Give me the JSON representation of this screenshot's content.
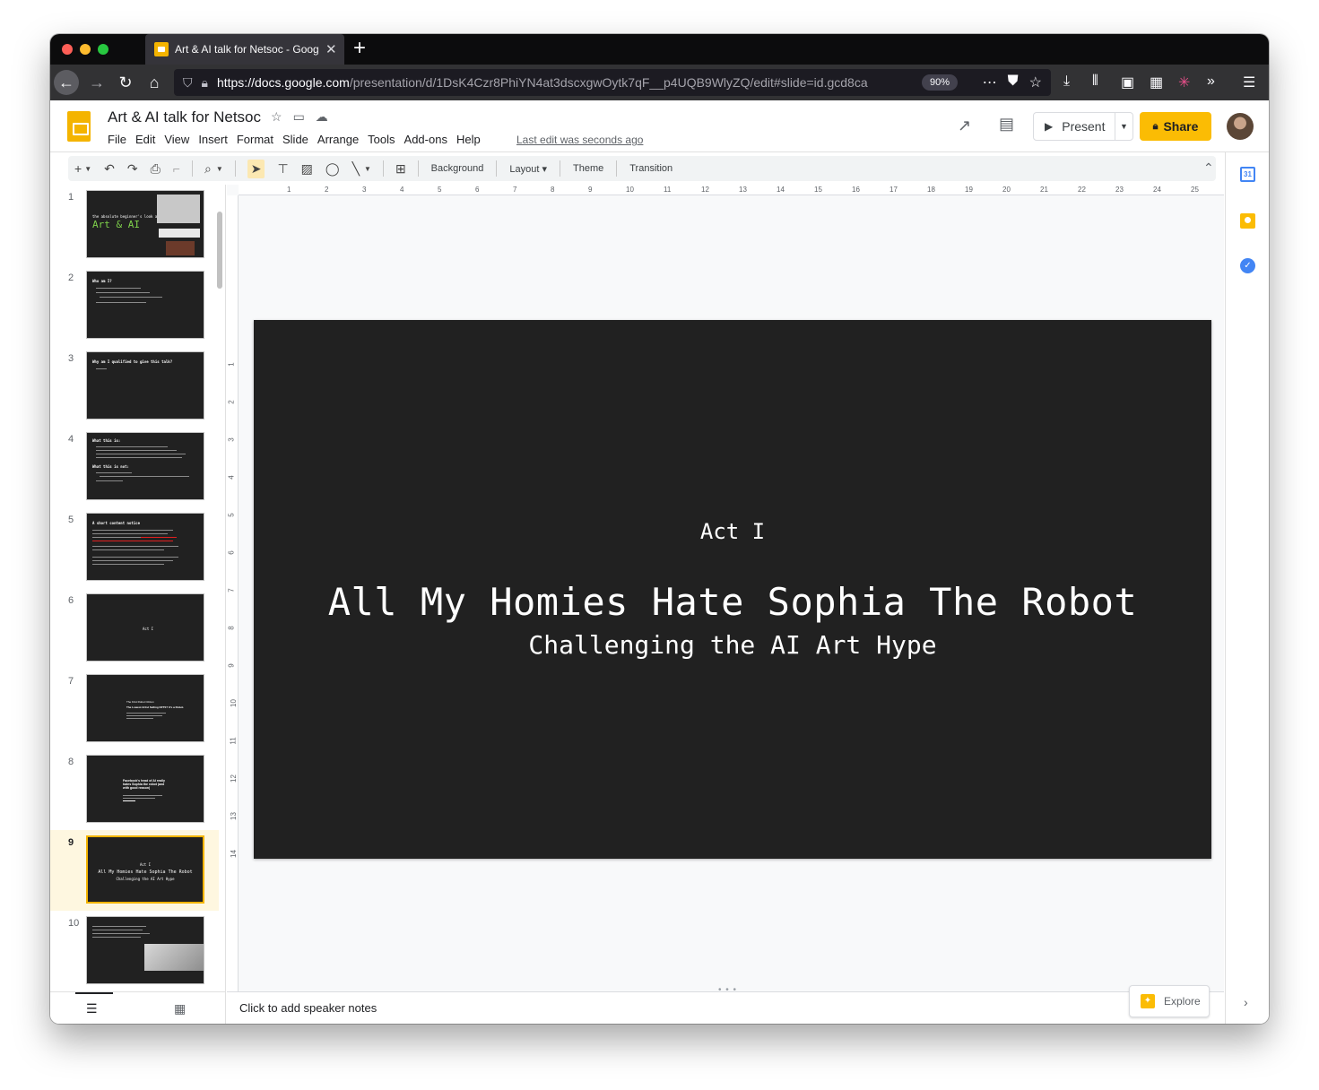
{
  "browser": {
    "tab_title": "Art & AI talk for Netsoc - Google Slides",
    "url_main": "https://docs.google.com",
    "url_rest": "/presentation/d/1DsK4Czr8PhiYN4at3dscxgwOytk7qF__p4UQB9WlyZQ/edit#slide=id.gcd8ca",
    "zoom": "90%"
  },
  "doc": {
    "title": "Art & AI talk for Netsoc",
    "last_edit": "Last edit was seconds ago",
    "menu": [
      "File",
      "Edit",
      "View",
      "Insert",
      "Format",
      "Slide",
      "Arrange",
      "Tools",
      "Add-ons",
      "Help"
    ],
    "present_label": "Present",
    "share_label": "Share"
  },
  "toolbar": {
    "background": "Background",
    "layout": "Layout",
    "theme": "Theme",
    "transition": "Transition"
  },
  "filmstrip": {
    "slides": [
      {
        "num": "1",
        "title": "the absolute beginner's look at",
        "big": "Art & AI"
      },
      {
        "num": "2",
        "title": "Who am I?"
      },
      {
        "num": "3",
        "title": "Why am I qualified to give this talk?"
      },
      {
        "num": "4",
        "title": "What this is:",
        "second": "What this is not:"
      },
      {
        "num": "5",
        "title": "A short content notice"
      },
      {
        "num": "6",
        "center": "Act I"
      },
      {
        "num": "7",
        "title": "The First Robot Citizen",
        "second": "The Lowest Artist Selling NFTS? It's a Robot."
      },
      {
        "num": "8",
        "title": "Facebook's head of AI really hates Sophia the robot (and with good reason)"
      },
      {
        "num": "9",
        "act": "Act I",
        "title": "All My Homies Hate Sophia The Robot",
        "sub": "Challenging the AI Art Hype"
      },
      {
        "num": "10"
      }
    ]
  },
  "slide": {
    "act": "Act I",
    "title": "All My Homies Hate Sophia The Robot",
    "subtitle": "Challenging the AI Art Hype"
  },
  "notes": {
    "placeholder": "Click to add speaker notes",
    "explore_label": "Explore"
  },
  "ruler": {
    "h": [
      "1",
      "2",
      "3",
      "4",
      "5",
      "6",
      "7",
      "8",
      "9",
      "10",
      "11",
      "12",
      "13",
      "14",
      "15",
      "16",
      "17",
      "18",
      "19",
      "20",
      "21",
      "22",
      "23",
      "24",
      "25"
    ],
    "v": [
      "1",
      "2",
      "3",
      "4",
      "5",
      "6",
      "7",
      "8",
      "9",
      "10",
      "11",
      "12",
      "13",
      "14"
    ]
  },
  "colors": {
    "accent": "#fbbc04",
    "slide_bg": "#212121"
  }
}
